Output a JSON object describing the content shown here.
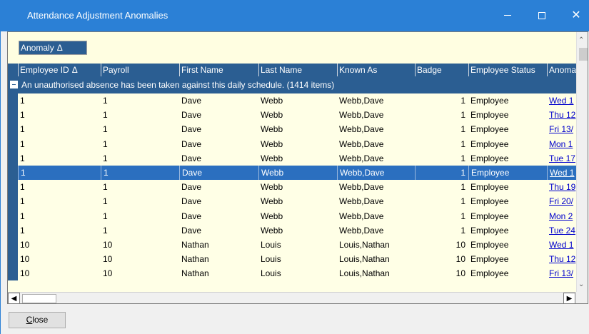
{
  "window": {
    "title": "Attendance Adjustment Anomalies",
    "minimize_icon": "minimize-icon",
    "maximize_icon": "maximize-icon",
    "close_glyph": "✕"
  },
  "group_by": {
    "label": "Anomaly",
    "sort_glyph": "Δ"
  },
  "columns": [
    {
      "label": "Employee ID",
      "sort_glyph": "Δ"
    },
    {
      "label": "Payroll"
    },
    {
      "label": "First Name"
    },
    {
      "label": "Last Name"
    },
    {
      "label": "Known As"
    },
    {
      "label": "Badge"
    },
    {
      "label": "Employee Status"
    },
    {
      "label": "Anoma"
    }
  ],
  "group": {
    "text": "An unauthorised absence has been taken against this daily schedule. (1414 items)"
  },
  "rows": [
    {
      "id": "1",
      "payroll": "1",
      "first": "Dave",
      "last": "Webb",
      "known": "Webb,Dave",
      "badge": "1",
      "status": "Employee",
      "anomaly": "Wed 1",
      "selected": false
    },
    {
      "id": "1",
      "payroll": "1",
      "first": "Dave",
      "last": "Webb",
      "known": "Webb,Dave",
      "badge": "1",
      "status": "Employee",
      "anomaly": "Thu 12",
      "selected": false
    },
    {
      "id": "1",
      "payroll": "1",
      "first": "Dave",
      "last": "Webb",
      "known": "Webb,Dave",
      "badge": "1",
      "status": "Employee",
      "anomaly": "Fri 13/",
      "selected": false
    },
    {
      "id": "1",
      "payroll": "1",
      "first": "Dave",
      "last": "Webb",
      "known": "Webb,Dave",
      "badge": "1",
      "status": "Employee",
      "anomaly": "Mon 1",
      "selected": false
    },
    {
      "id": "1",
      "payroll": "1",
      "first": "Dave",
      "last": "Webb",
      "known": "Webb,Dave",
      "badge": "1",
      "status": "Employee",
      "anomaly": "Tue 17",
      "selected": false
    },
    {
      "id": "1",
      "payroll": "1",
      "first": "Dave",
      "last": "Webb",
      "known": "Webb,Dave",
      "badge": "1",
      "status": "Employee",
      "anomaly": "Wed 1",
      "selected": true
    },
    {
      "id": "1",
      "payroll": "1",
      "first": "Dave",
      "last": "Webb",
      "known": "Webb,Dave",
      "badge": "1",
      "status": "Employee",
      "anomaly": "Thu 19",
      "selected": false
    },
    {
      "id": "1",
      "payroll": "1",
      "first": "Dave",
      "last": "Webb",
      "known": "Webb,Dave",
      "badge": "1",
      "status": "Employee",
      "anomaly": "Fri 20/",
      "selected": false
    },
    {
      "id": "1",
      "payroll": "1",
      "first": "Dave",
      "last": "Webb",
      "known": "Webb,Dave",
      "badge": "1",
      "status": "Employee",
      "anomaly": "Mon 2",
      "selected": false
    },
    {
      "id": "1",
      "payroll": "1",
      "first": "Dave",
      "last": "Webb",
      "known": "Webb,Dave",
      "badge": "1",
      "status": "Employee",
      "anomaly": "Tue 24",
      "selected": false
    },
    {
      "id": "10",
      "payroll": "10",
      "first": "Nathan",
      "last": "Louis",
      "known": "Louis,Nathan",
      "badge": "10",
      "status": "Employee",
      "anomaly": "Wed 1",
      "selected": false
    },
    {
      "id": "10",
      "payroll": "10",
      "first": "Nathan",
      "last": "Louis",
      "known": "Louis,Nathan",
      "badge": "10",
      "status": "Employee",
      "anomaly": "Thu 12",
      "selected": false
    },
    {
      "id": "10",
      "payroll": "10",
      "first": "Nathan",
      "last": "Louis",
      "known": "Louis,Nathan",
      "badge": "10",
      "status": "Employee",
      "anomaly": "Fri 13/",
      "selected": false
    }
  ],
  "close_button": {
    "underlined": "C",
    "rest": "lose"
  }
}
